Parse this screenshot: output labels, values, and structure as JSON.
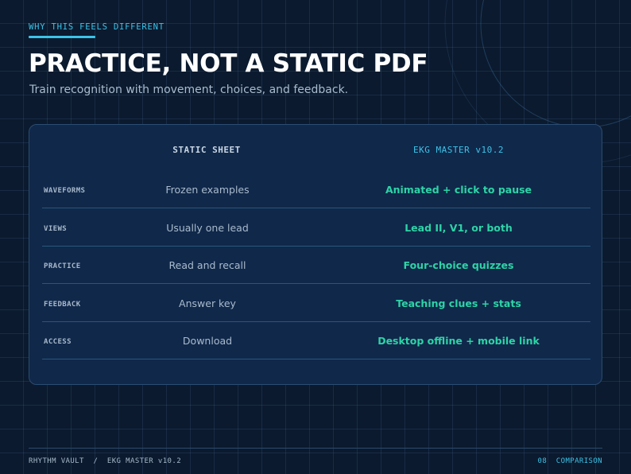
{
  "header": {
    "eyebrow": "WHY THIS FEELS DIFFERENT",
    "title": "PRACTICE, NOT A STATIC PDF",
    "subtitle": "Train recognition with movement, choices, and feedback."
  },
  "comparison": {
    "columns": [
      "STATIC SHEET",
      "EKG MASTER v10.2"
    ],
    "rows": [
      {
        "label": "WAVEFORMS",
        "static": "Frozen examples",
        "ekg": "Animated + click to pause"
      },
      {
        "label": "VIEWS",
        "static": "Usually one lead",
        "ekg": "Lead II, V1, or both"
      },
      {
        "label": "PRACTICE",
        "static": "Read and recall",
        "ekg": "Four-choice quizzes"
      },
      {
        "label": "FEEDBACK",
        "static": "Answer key",
        "ekg": "Teaching clues + stats"
      },
      {
        "label": "ACCESS",
        "static": "Download",
        "ekg": "Desktop offline + mobile link"
      }
    ]
  },
  "footer": {
    "left": "RHYTHM VAULT  /  EKG MASTER v10.2",
    "right": "08  COMPARISON"
  },
  "colors": {
    "background": "#0b1a2e",
    "accent": "#3cc3e8",
    "highlight": "#2dd4a7",
    "card": "#10284a"
  }
}
